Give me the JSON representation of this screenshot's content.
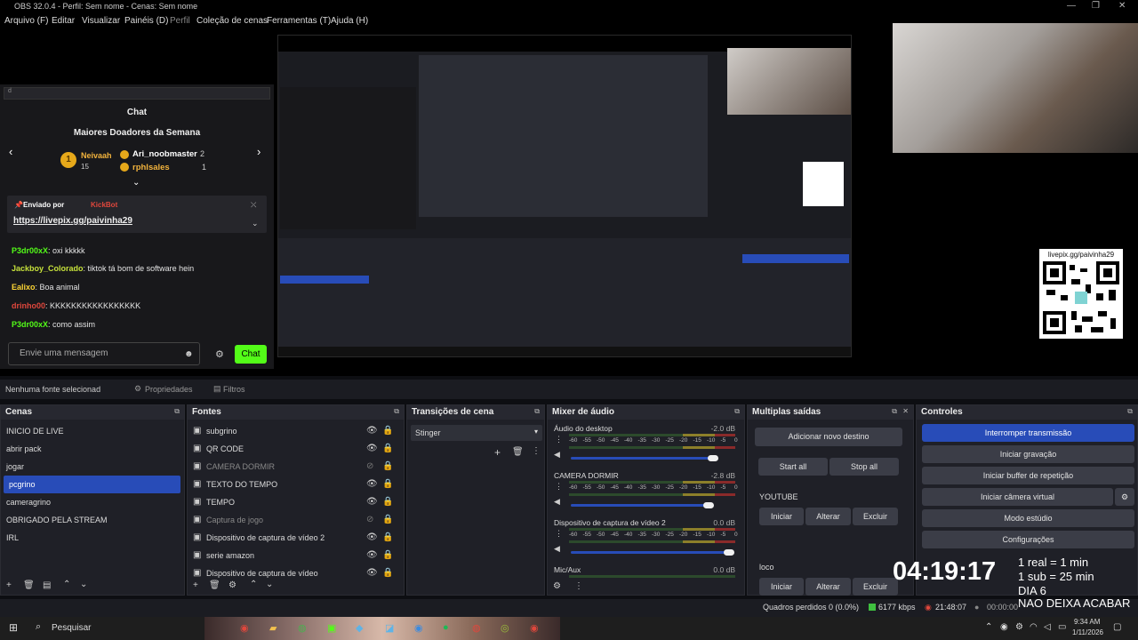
{
  "window": {
    "title": "OBS 32.0.4 - Perfil: Sem nome - Cenas: Sem nome"
  },
  "menu": [
    "Arquivo (F)",
    "Editar",
    "Visualizar",
    "Painéis (D)",
    "Perfil",
    "Coleção de cenas",
    "Ferramentas (T)",
    "Ajuda (H)"
  ],
  "chat": {
    "search_placeholder": "d",
    "title": "Chat",
    "donors_title": "Maiores Doadores da Semana",
    "donors": [
      {
        "rank": "1",
        "name": "Neivaah",
        "amount": "15"
      },
      {
        "rank": "",
        "name": "Ari_noobmaster",
        "amount": "2"
      },
      {
        "rank": "",
        "name": "rphlsales",
        "amount": "1"
      }
    ],
    "sent_by_label": "Enviado por",
    "sent_by_name": "KickBot",
    "sent_link": "https://livepix.gg/paivinha29",
    "messages": [
      {
        "user": "P3dr00xX",
        "text": "oxi kkkkk",
        "color": "#53fc18"
      },
      {
        "user": "Jackboy_Colorado",
        "text": "tiktok tá bom de software hein",
        "color": "#c6e13b"
      },
      {
        "user": "Ealixo",
        "text": "Boa animal",
        "color": "#fcd535"
      },
      {
        "user": "drinho00",
        "text": "KKKKKKKKKKKKKKKKK",
        "color": "#e0473c"
      },
      {
        "user": "P3dr00xX",
        "text": "como assim",
        "color": "#53fc18"
      }
    ],
    "input_placeholder": "Envie uma mensagem",
    "send_button": "Chat"
  },
  "qr": {
    "label": "livepix.gg/paivinha29"
  },
  "source_bar": {
    "none_selected": "Nenhuma fonte selecionad",
    "properties": "Propriedades",
    "filters": "Filtros"
  },
  "scenes": {
    "title": "Cenas",
    "items": [
      "INICIO DE LIVE",
      "abrir pack",
      "jogar",
      "pcgrino",
      "cameragrino",
      "OBRIGADO PELA STREAM",
      "IRL"
    ],
    "selected": "pcgrino"
  },
  "sources": {
    "title": "Fontes",
    "items": [
      {
        "name": "subgrino",
        "visible": true
      },
      {
        "name": "QR CODE",
        "visible": true
      },
      {
        "name": "CAMERA DORMIR",
        "visible": false
      },
      {
        "name": "TEXTO DO TEMPO",
        "visible": true
      },
      {
        "name": "TEMPO",
        "visible": true
      },
      {
        "name": "Captura de jogo",
        "visible": false
      },
      {
        "name": "Dispositivo de captura de vídeo 2",
        "visible": true
      },
      {
        "name": "serie amazon",
        "visible": true
      },
      {
        "name": "Dispositivo de captura de vídeo",
        "visible": true
      }
    ]
  },
  "transitions": {
    "title": "Transições de cena",
    "selected": "Stinger"
  },
  "mixer": {
    "title": "Mixer de áudio",
    "ticks": [
      "-60",
      "-55",
      "-50",
      "-45",
      "-40",
      "-35",
      "-30",
      "-25",
      "-20",
      "-15",
      "-10",
      "-5",
      "0"
    ],
    "channels": [
      {
        "name": "Áudio do desktop",
        "db": "-2.0 dB",
        "level": 0.9
      },
      {
        "name": "CAMERA DORMIR",
        "db": "-2.8 dB",
        "level": 0.87
      },
      {
        "name": "Dispositivo de captura de vídeo 2",
        "db": "0.0 dB",
        "level": 1.0
      },
      {
        "name": "Mic/Aux",
        "db": "0.0 dB",
        "level": 1.0
      }
    ]
  },
  "multi": {
    "title": "Multiplas saídas",
    "add": "Adicionar novo destino",
    "start_all": "Start all",
    "stop_all": "Stop all",
    "outputs": [
      {
        "name": "YOUTUBE",
        "start": "Iniciar",
        "edit": "Alterar",
        "delete": "Excluir"
      },
      {
        "name": "loco",
        "start": "Iniciar",
        "edit": "Alterar",
        "delete": "Excluir"
      }
    ]
  },
  "controls": {
    "title": "Controles",
    "buttons": [
      "Interromper transmissão",
      "Iniciar gravação",
      "Iniciar buffer de repetição",
      "Iniciar câmera virtual",
      "Modo estúdio",
      "Configurações"
    ]
  },
  "overlay": {
    "clock": "04:19:17",
    "lines": [
      "1 real = 1 min",
      "1 sub = 25 min",
      "DIA 6",
      "NAO DEIXA ACABAR"
    ]
  },
  "status": {
    "dropped": "Quadros perdidos 0 (0.0%)",
    "bitrate": "6177 kbps",
    "stream_time": "21:48:07",
    "rec_time": "00:00:00"
  },
  "taskbar": {
    "search": "Pesquisar",
    "time": "9:34 AM",
    "date": "1/11/2026"
  },
  "colors": {
    "accent": "#284cb8",
    "kick_green": "#53fc18",
    "dock_bg": "#1f2027"
  }
}
